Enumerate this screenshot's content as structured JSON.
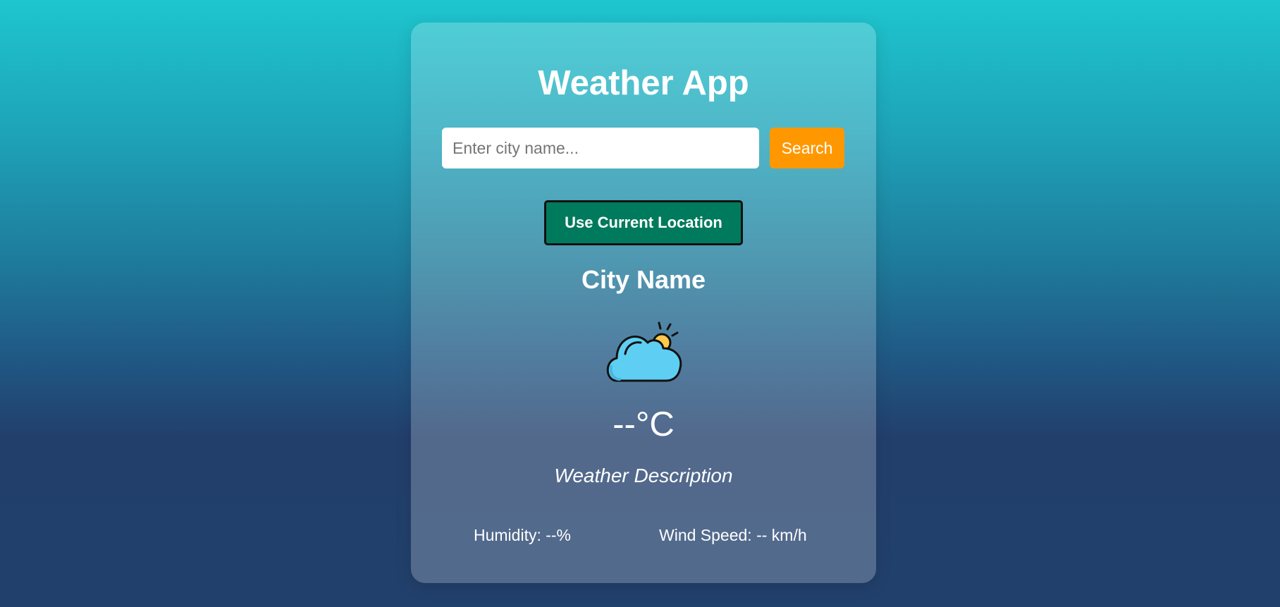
{
  "app": {
    "title": "Weather App"
  },
  "search": {
    "placeholder": "Enter city name...",
    "value": "",
    "button_label": "Search"
  },
  "location": {
    "button_label": "Use Current Location"
  },
  "weather": {
    "city": "City Name",
    "icon": "partly-cloudy-icon",
    "temperature": "--°C",
    "description": "Weather Description",
    "humidity": "Humidity: --%",
    "wind_speed": "Wind Speed: -- km/h"
  },
  "colors": {
    "search_button": "#ff9800",
    "location_button": "#007a5c",
    "cloud": "#5ecff2",
    "sun": "#ffc94d"
  }
}
